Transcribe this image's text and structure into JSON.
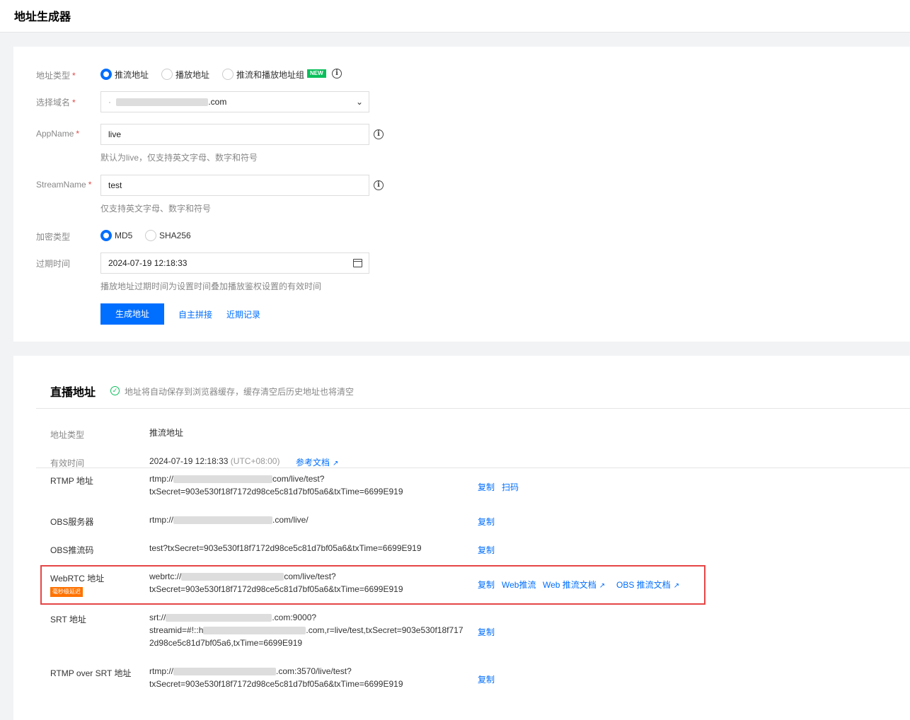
{
  "page": {
    "title": "地址生成器"
  },
  "form": {
    "address_type_label": "地址类型",
    "address_types": [
      "推流地址",
      "播放地址",
      "推流和播放地址组"
    ],
    "new_badge": "NEW",
    "domain_label": "选择域名",
    "domain_value_suffix": ".com",
    "appname_label": "AppName",
    "appname_value": "live",
    "appname_hint": "默认为live，仅支持英文字母、数字和符号",
    "streamname_label": "StreamName",
    "streamname_value": "test",
    "streamname_hint": "仅支持英文字母、数字和符号",
    "encrypt_label": "加密类型",
    "encrypt_types": [
      "MD5",
      "SHA256"
    ],
    "expire_label": "过期时间",
    "expire_value": "2024-07-19 12:18:33",
    "expire_hint": "播放地址过期时间为设置时间叠加播放鉴权设置的有效时间",
    "generate_button": "生成地址",
    "custom_link": "自主拼接",
    "recent_link": "近期记录"
  },
  "result": {
    "title": "直播地址",
    "notice": "地址将自动保存到浏览器缓存，缓存清空后历史地址也将清空",
    "type_label": "地址类型",
    "type_value": "推流地址",
    "valid_label": "有效时间",
    "valid_value": "2024-07-19 12:18:33",
    "valid_tz": "(UTC+08:00)",
    "ref_doc": "参考文档",
    "rows": {
      "rtmp": {
        "label": "RTMP 地址",
        "line1_prefix": "rtmp://",
        "line1_suffix": "com/live/test?",
        "line2": "txSecret=903e530f18f7172d98ce5c81d7bf05a6&txTime=6699E919",
        "copy": "复制",
        "scan": "扫码"
      },
      "obs_server": {
        "label": "OBS服务器",
        "line1_prefix": "rtmp://",
        "line1_suffix": ".com/live/",
        "copy": "复制"
      },
      "obs_key": {
        "label": "OBS推流码",
        "line1": "test?txSecret=903e530f18f7172d98ce5c81d7bf05a6&txTime=6699E919",
        "copy": "复制"
      },
      "webrtc": {
        "label": "WebRTC 地址",
        "badge": "毫秒级延迟",
        "line1_prefix": "webrtc://",
        "line1_suffix": "com/live/test?",
        "line2": "txSecret=903e530f18f7172d98ce5c81d7bf05a6&txTime=6699E919",
        "copy": "复制",
        "web_push": "Web推流",
        "web_doc": "Web 推流文档",
        "obs_doc": "OBS 推流文档"
      },
      "srt": {
        "label": "SRT 地址",
        "line1_prefix": "srt://",
        "line1_suffix": ".com:9000?",
        "line2_prefix": "streamid=#!::h",
        "line2_suffix": ".com,r=live/test,txSecret=903e530f18f717",
        "line3": "2d98ce5c81d7bf05a6,txTime=6699E919",
        "copy": "复制"
      },
      "rtmp_srt": {
        "label": "RTMP over SRT 地址",
        "line1_prefix": "rtmp://",
        "line1_suffix": ".com:3570/live/test?",
        "line2": "txSecret=903e530f18f7172d98ce5c81d7bf05a6&txTime=6699E919",
        "copy": "复制"
      }
    }
  }
}
